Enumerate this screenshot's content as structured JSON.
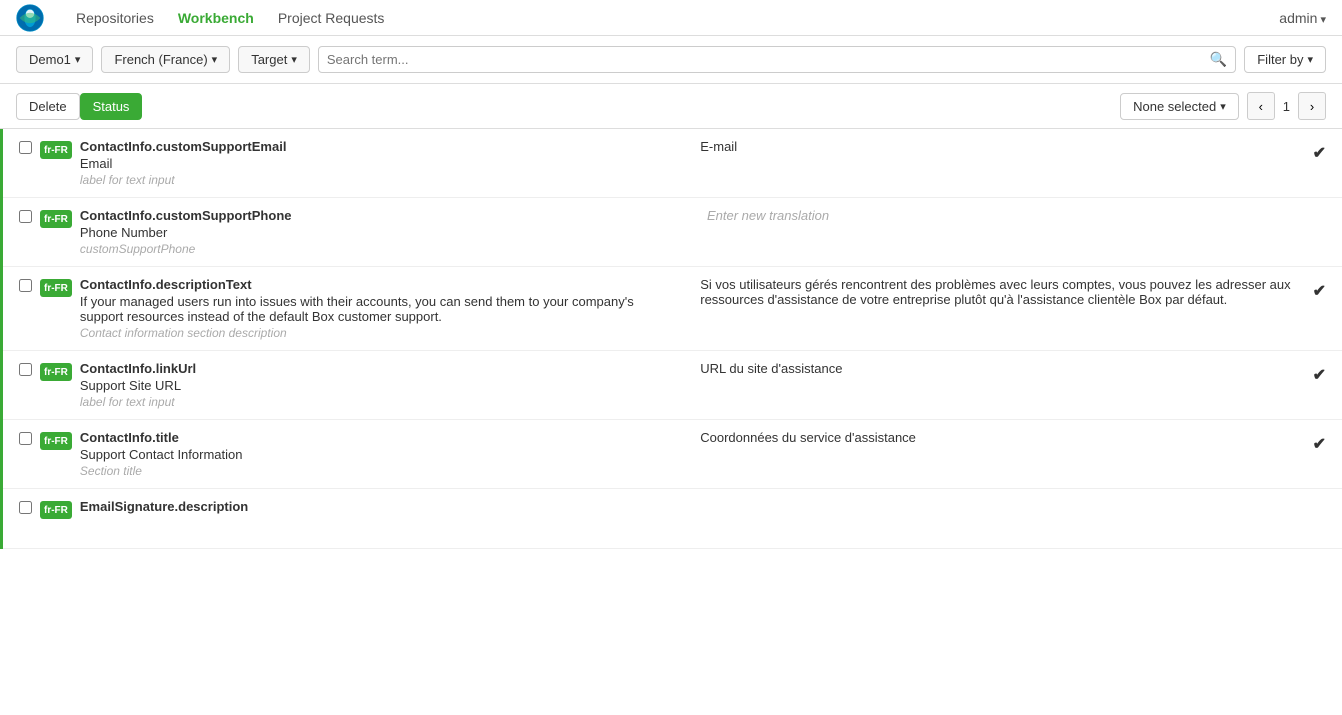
{
  "app": {
    "logo_alt": "Box logo"
  },
  "nav": {
    "links": [
      {
        "label": "Repositories",
        "active": false
      },
      {
        "label": "Workbench",
        "active": true
      },
      {
        "label": "Project Requests",
        "active": false
      }
    ],
    "user": "admin"
  },
  "toolbar": {
    "project_btn": "Demo1",
    "language_btn": "French (France)",
    "target_btn": "Target",
    "search_placeholder": "Search term...",
    "filter_btn": "Filter by"
  },
  "action_bar": {
    "delete_btn": "Delete",
    "status_btn": "Status",
    "none_selected_btn": "None selected",
    "page_prev": "‹",
    "page_num": "1",
    "page_next": "›"
  },
  "rows": [
    {
      "tag": "fr-FR",
      "key": "ContactInfo.customSupportEmail",
      "source": "Email",
      "context": "label for text input",
      "translation": "E-mail",
      "has_translation": true,
      "placeholder": ""
    },
    {
      "tag": "fr-FR",
      "key": "ContactInfo.customSupportPhone",
      "source": "Phone Number",
      "context": "customSupportPhone",
      "translation": "",
      "has_translation": false,
      "placeholder": "Enter new translation"
    },
    {
      "tag": "fr-FR",
      "key": "ContactInfo.descriptionText",
      "source": "If your managed users run into issues with their accounts, you can send them to your company's support resources instead of the default Box customer support.",
      "context": "Contact information section description",
      "translation": "Si vos utilisateurs gérés rencontrent des problèmes avec leurs comptes, vous pouvez les adresser aux ressources d'assistance de votre entreprise plutôt qu'à l'assistance clientèle Box par défaut.",
      "has_translation": true,
      "placeholder": ""
    },
    {
      "tag": "fr-FR",
      "key": "ContactInfo.linkUrl",
      "source": "Support Site URL",
      "context": "label for text input",
      "translation": "URL du site d'assistance",
      "has_translation": true,
      "placeholder": ""
    },
    {
      "tag": "fr-FR",
      "key": "ContactInfo.title",
      "source": "Support Contact Information",
      "context": "Section title",
      "translation": "Coordonnées du service d'assistance",
      "has_translation": true,
      "placeholder": ""
    },
    {
      "tag": "fr-FR",
      "key": "EmailSignature.description",
      "source": "",
      "context": "",
      "translation": "",
      "has_translation": false,
      "placeholder": ""
    }
  ]
}
